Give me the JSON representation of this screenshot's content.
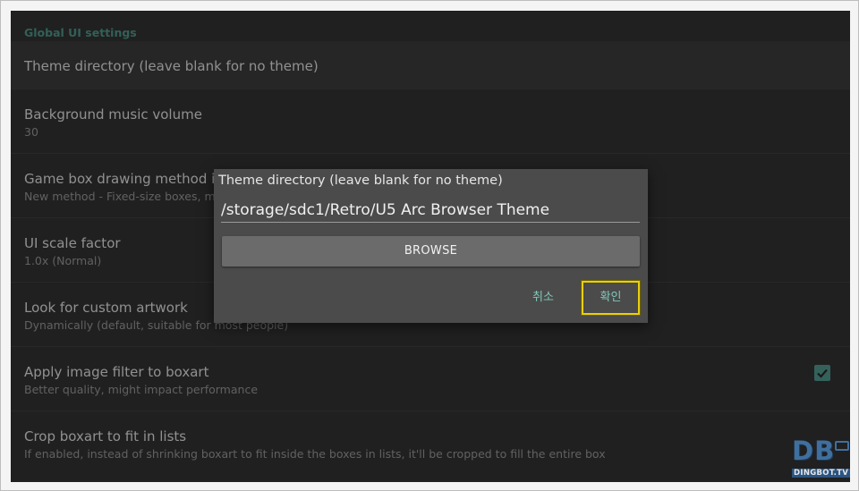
{
  "settings": {
    "section_header": "Global UI settings",
    "rows": [
      {
        "title": "Theme directory (leave blank for no theme)",
        "subtitle": ""
      },
      {
        "title": "Background music volume",
        "subtitle": "30"
      },
      {
        "title": "Game box drawing method in l",
        "subtitle": "New method - Fixed-size boxes, mu"
      },
      {
        "title": "UI scale factor",
        "subtitle": "1.0x (Normal)"
      },
      {
        "title": "Look for custom artwork",
        "subtitle": "Dynamically (default, suitable for most people)"
      },
      {
        "title": "Apply image filter to boxart",
        "subtitle": "Better quality, might impact performance",
        "checked": true
      },
      {
        "title": "Crop boxart to fit in lists",
        "subtitle": "If enabled, instead of shrinking boxart to fit inside the boxes in lists, it'll be cropped to fill the entire box"
      }
    ]
  },
  "dialog": {
    "title": "Theme directory (leave blank for no theme)",
    "input_value": "/storage/sdc1/Retro/U5 Arc Browser Theme",
    "browse_label": "BROWSE",
    "cancel_label": "취소",
    "ok_label": "확인"
  },
  "watermark": {
    "logo": "DB",
    "sub": "DINGBOT.TV"
  },
  "colors": {
    "accent": "#4a8e80",
    "button_text": "#7fc8b8",
    "focus": "#e9d00b"
  }
}
